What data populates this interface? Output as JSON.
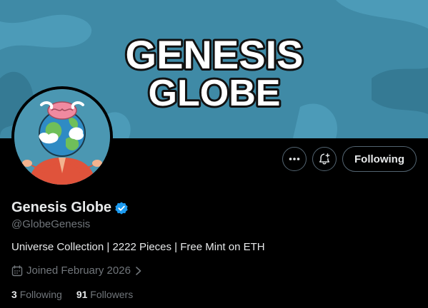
{
  "banner": {
    "logo_line1": "GENESIS",
    "logo_line2": "GLOBE",
    "background_color": "#3f8aa6"
  },
  "avatar": {
    "icon": "genesis-globe-avatar"
  },
  "actions": {
    "more_icon": "more-dots-icon",
    "notify_icon": "bell-plus-icon",
    "following_label": "Following"
  },
  "profile": {
    "display_name": "Genesis Globe",
    "verified_icon": "verified-badge-icon",
    "handle": "@GlobeGenesis",
    "bio": "Universe Collection | 2222 Pieces | Free Mint on ETH",
    "joined_icon": "calendar-icon",
    "joined": "Joined February 2026",
    "chevron_icon": "chevron-right-icon"
  },
  "stats": {
    "following_count": "3",
    "following_label": "Following",
    "followers_count": "91",
    "followers_label": "Followers"
  },
  "colors": {
    "verified": "#1d9bf0",
    "muted": "#71767b",
    "text": "#e7e9ea",
    "border": "#536471"
  }
}
